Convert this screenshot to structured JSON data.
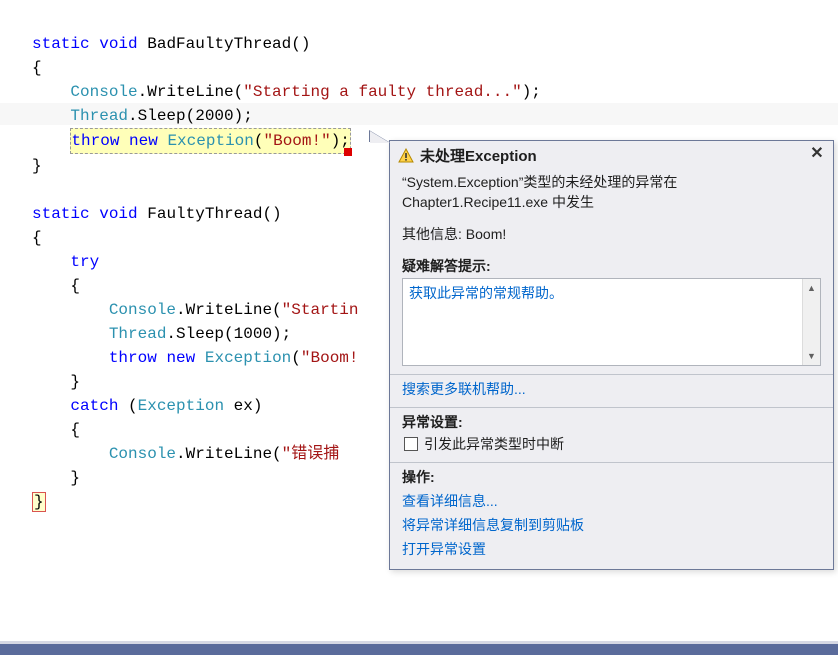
{
  "code": {
    "l1_kw1": "static",
    "l1_kw2": "void",
    "l1_name": "BadFaultyThread()",
    "l2_brace": "{",
    "l3_cls": "Console",
    "l3_dot": ".WriteLine(",
    "l3_str": "\"Starting a faulty thread...\"",
    "l3_end": ");",
    "l4_cls": "Thread",
    "l4_rest": ".Sleep(2000);",
    "l5_kw1": "throw",
    "l5_kw2": "new",
    "l5_cls": "Exception",
    "l5_paren": "(",
    "l5_str": "\"Boom!\"",
    "l5_end": ");",
    "l6_brace": "}",
    "l8_kw1": "static",
    "l8_kw2": "void",
    "l8_name": "FaultyThread()",
    "l9_brace": "{",
    "l10_kw": "try",
    "l11_brace": "{",
    "l12_cls": "Console",
    "l12_dot": ".WriteLine(",
    "l12_str": "\"Startin",
    "l13_cls": "Thread",
    "l13_rest": ".Sleep(1000);",
    "l14_kw1": "throw",
    "l14_kw2": "new",
    "l14_cls": "Exception",
    "l14_paren": "(",
    "l14_str": "\"Boom!",
    "l15_brace": "}",
    "l16_kw": "catch",
    "l16_paren": " (",
    "l16_cls": "Exception",
    "l16_rest": " ex)",
    "l17_brace": "{",
    "l18_cls": "Console",
    "l18_dot": ".WriteLine(",
    "l18_str": "\"错误捕",
    "l19_brace": "}",
    "l20_brace": "}"
  },
  "popup": {
    "title": "未处理Exception",
    "message1": "“System.Exception”类型的未经处理的异常在 Chapter1.Recipe11.exe 中发生",
    "other_info": "其他信息: Boom!",
    "tips_label": "疑难解答提示:",
    "tips_link": "获取此异常的常规帮助。",
    "search_link": "搜索更多联机帮助...",
    "settings_label": "异常设置:",
    "settings_chk": "引发此异常类型时中断",
    "actions_label": "操作:",
    "action1": "查看详细信息...",
    "action2": "将异常详细信息复制到剪贴板",
    "action3": "打开异常设置"
  }
}
